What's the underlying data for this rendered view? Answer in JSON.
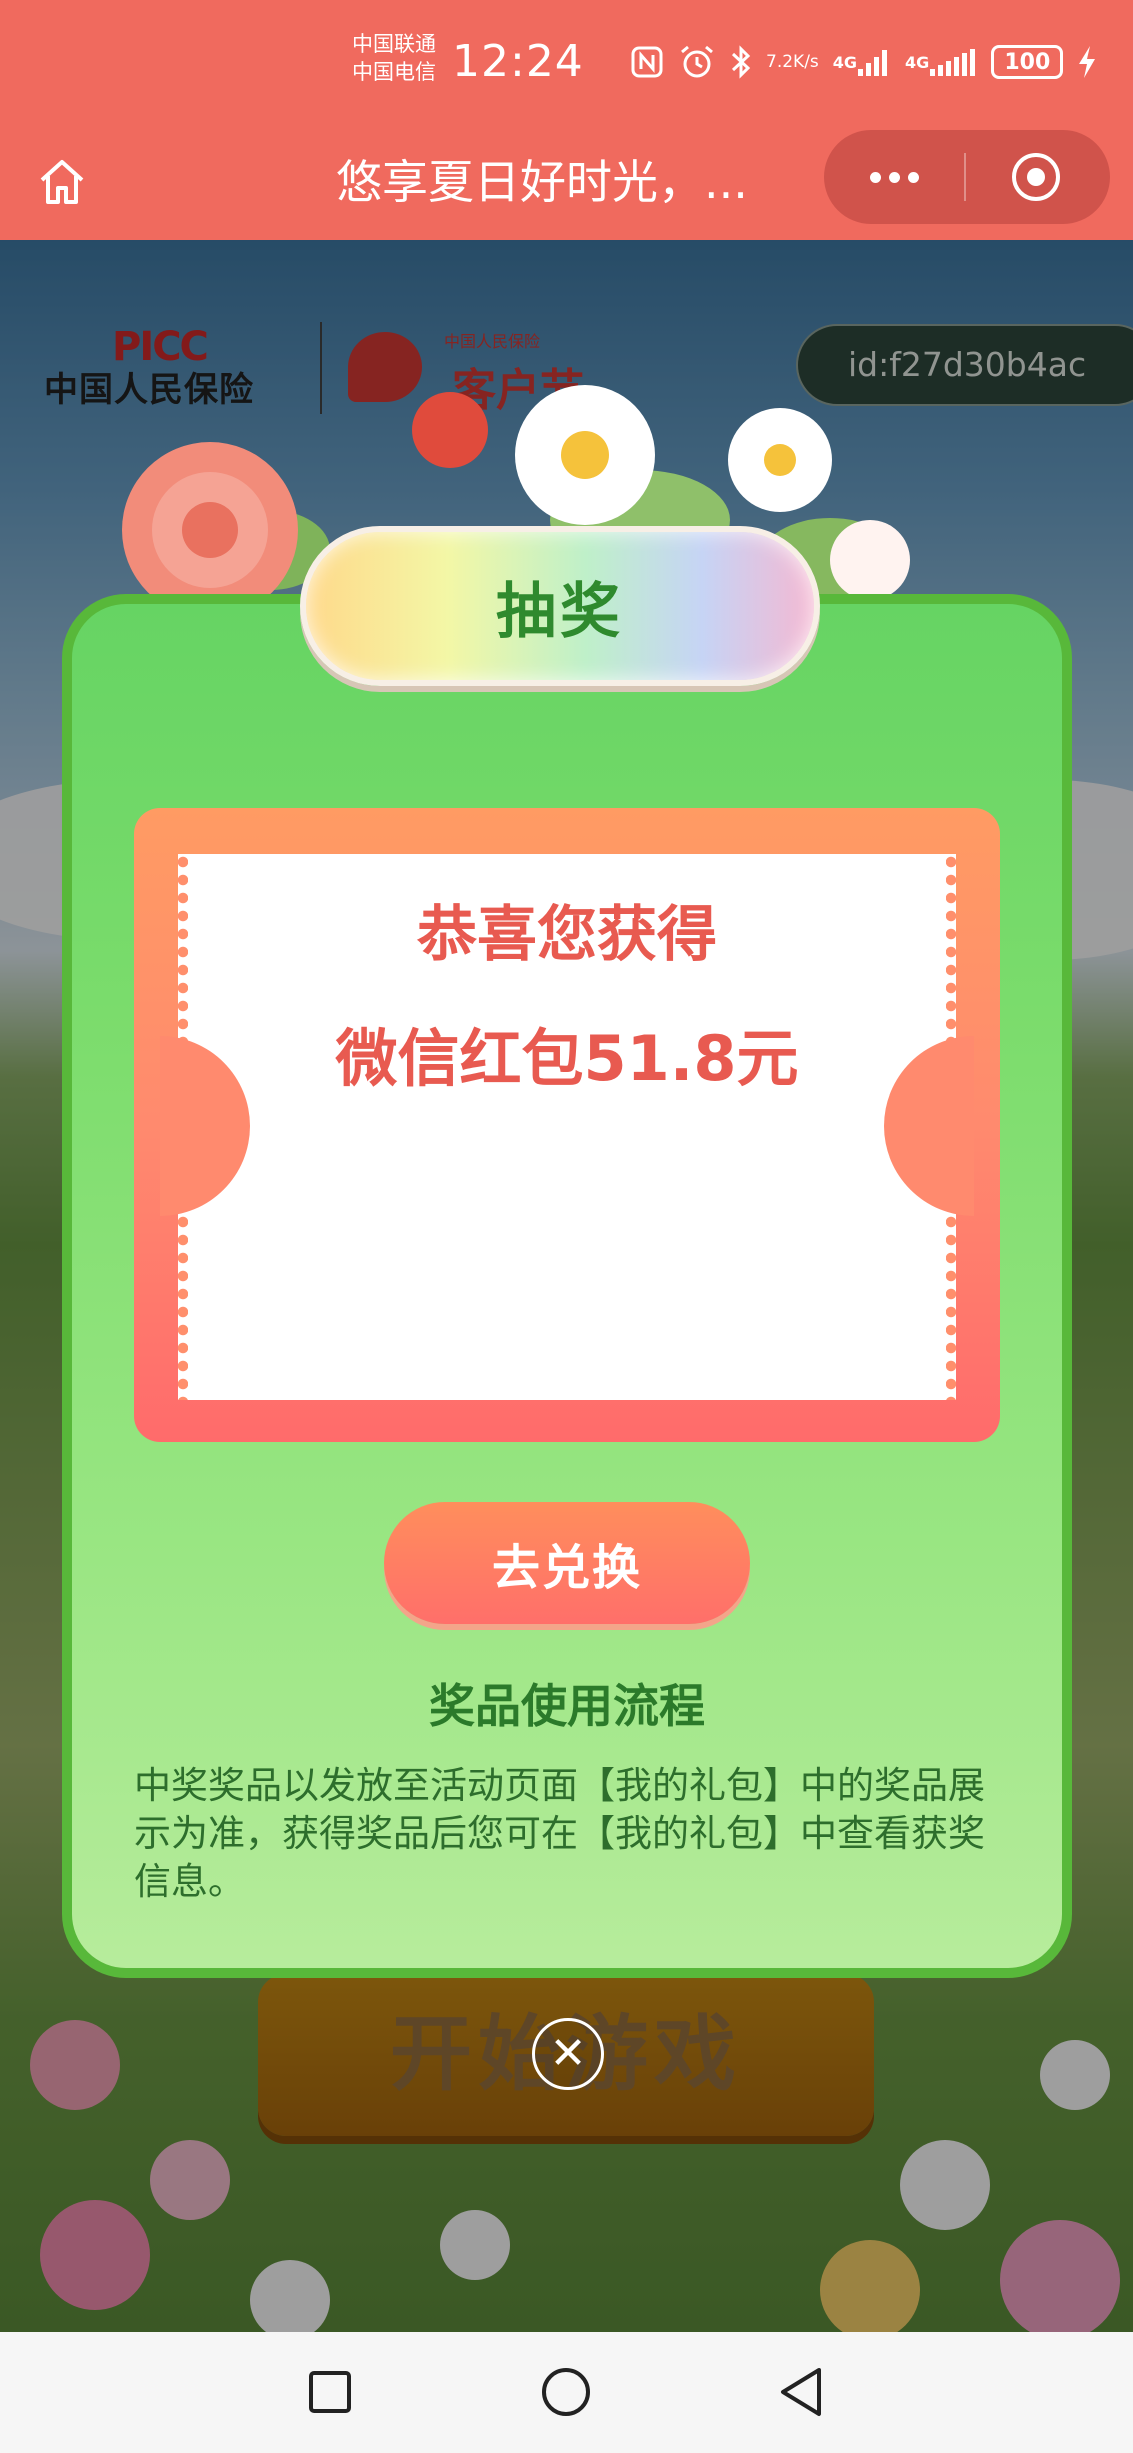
{
  "status_bar": {
    "carrier_1": "中国联通",
    "carrier_2": "中国电信",
    "time": "12:24",
    "net_speed_value": "7.2",
    "net_speed_unit": "K/s",
    "network_1": "4G",
    "network_2": "4G",
    "battery": "100"
  },
  "nav": {
    "title": "悠享夏日好时光，..."
  },
  "header": {
    "logo_picc_en": "PICC",
    "logo_picc_cn": "中国人民保险",
    "logo_khj_small": "中国人民保险",
    "logo_khj_big": "客户节",
    "user_id": "id:f27d30b4ac"
  },
  "modal": {
    "title": "抽奖",
    "win_line1": "恭喜您获得",
    "win_line2": "微信红包51.8元",
    "redeem_button": "去兑换",
    "usage_title": "奖品使用流程",
    "usage_desc": "中奖奖品以发放至活动页面【我的礼包】中的奖品展示为准，获得奖品后您可在【我的礼包】中查看获奖信息。",
    "close_symbol": "✕"
  },
  "background": {
    "start_button": "开始游戏"
  },
  "colors": {
    "status_bar": "#f06a5e",
    "modal_green": "#66d463",
    "prize_text": "#e85a50",
    "title_text": "#2f8a2e"
  }
}
